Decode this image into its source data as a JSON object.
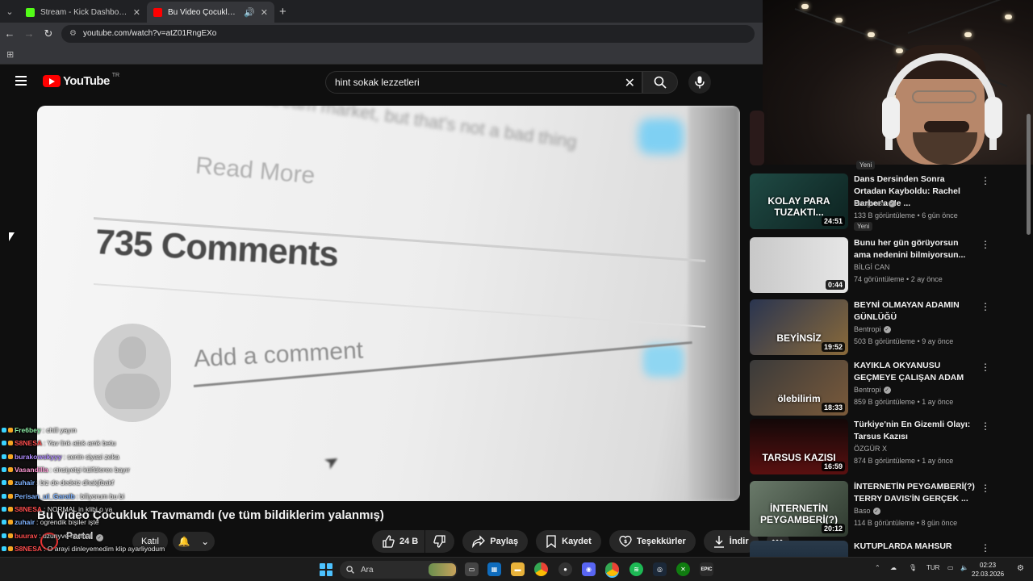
{
  "browser": {
    "tabs": [
      {
        "title": "Stream - Kick Dashboard",
        "favicon_color": "#53fc18",
        "active": false
      },
      {
        "title": "Bu Video Çocukluk Travmamdı",
        "favicon_color": "#ff0000",
        "active": true
      }
    ],
    "new_tab_label": "+",
    "url": "youtube.com/watch?v=atZ01RngEXo"
  },
  "youtube": {
    "logo_text": "YouTube",
    "country_code": "TR",
    "search_value": "hint sokak lezzetleri"
  },
  "video": {
    "frame_text_top": "mainstream market, but that's not a bad thing",
    "frame_read_more": "Read More",
    "frame_comments": "735 Comments",
    "frame_add_comment": "Add a comment",
    "title": "Bu Video Çocukluk Travmamdı (ve tüm bildiklerim yalanmış)",
    "channel_name": "Partal",
    "join_label": "Katıl",
    "like_count": "24 B",
    "share_label": "Paylaş",
    "save_label": "Kaydet",
    "thanks_label": "Teşekkürler",
    "download_label": "İndir"
  },
  "chat": [
    {
      "user": "Fre6bey",
      "msg": ": chill yayın",
      "color": "#8be9a3"
    },
    {
      "user": "S8NESA",
      "msg": ": Yav link attık amk betu",
      "color": "#ff4d4d"
    },
    {
      "user": "burakowskyyy",
      "msg": ": senin siyasi zeka",
      "color": "#b18cff"
    },
    {
      "user": "Vasandilla",
      "msg": ": cinsiyetçi külfülerex bayır",
      "color": "#ff9ad5"
    },
    {
      "user": "zuhair",
      "msg": ": biz de dedeiz dhakjfbakf",
      "color": "#7fb3ff"
    },
    {
      "user": "Perisan_ul_Garaib",
      "msg": ": biliyorum bu bi",
      "color": "#7fb3ff"
    },
    {
      "user": "S8NESA",
      "msg": ": NORMAL in klibi o ya",
      "color": "#ff4d4d"
    },
    {
      "user": "zuhair",
      "msg": ": ogrendik bişiler işte",
      "color": "#7fb3ff"
    },
    {
      "user": "buurav",
      "msg": ": uzunyve normal",
      "color": "#ff4d4d"
    },
    {
      "user": "S8NESA",
      "msg": ": O arayi dinleyemedim klip ayarliyodum",
      "color": "#ff4d4d"
    },
    {
      "user": "S8NESA",
      "msg": ": Banlandı mı",
      "color": "#ff4d4d"
    },
    {
      "user": "Perisan_ul_Garaib",
      "msg": ": ne olcak aw cinayet işte",
      "color": "#7fb3ff"
    }
  ],
  "sidebar": {
    "top_badge": "Yeni",
    "recs": [
      {
        "title": "Dans Dersinden Sonra Ortadan Kayboldu: Rachel Barber'a Ne ...",
        "channel": "Pangvoss",
        "verified": true,
        "meta": "133 B görüntüleme • 6 gün önce",
        "duration": "24:51",
        "badge": "Yeni",
        "thumb_text": "KOLAY PARA TUZAKTI...",
        "thumb_bg": "linear-gradient(135deg,#1f4a44,#0d2220)"
      },
      {
        "title": "Bunu her gün görüyorsun ama nedenini bilmiyorsun...",
        "channel": "BİLGİ CAN",
        "verified": false,
        "meta": "74 görüntüleme • 2 ay önce",
        "duration": "0:44",
        "badge": "",
        "thumb_text": "",
        "thumb_bg": "linear-gradient(90deg,#c8c8c8,#e6e6e6)"
      },
      {
        "title": "BEYNİ OLMAYAN ADAMIN GÜNLÜĞÜ",
        "channel": "Bentropi",
        "verified": true,
        "meta": "503 B görüntüleme • 9 ay önce",
        "duration": "19:52",
        "badge": "",
        "thumb_text": "BEYİNSİZ",
        "thumb_bg": "linear-gradient(135deg,#2a3550,#8a6a3a)"
      },
      {
        "title": "KAYIKLA OKYANUSU GEÇMEYE ÇALIŞAN ADAM",
        "channel": "Bentropi",
        "verified": true,
        "meta": "859 B görüntüleme • 1 ay önce",
        "duration": "18:33",
        "badge": "",
        "thumb_text": "ölebilirim",
        "thumb_bg": "linear-gradient(135deg,#3a3a3a,#7a5a3a)"
      },
      {
        "title": "Türkiye'nin En Gizemli Olayı: Tarsus Kazısı",
        "channel": "ÖZGÜR X",
        "verified": false,
        "meta": "874 B görüntüleme • 1 ay önce",
        "duration": "16:59",
        "badge": "",
        "thumb_text": "TARSUS KAZISI",
        "thumb_bg": "linear-gradient(180deg,#120808,#5a1010)"
      },
      {
        "title": "İNTERNETİN PEYGAMBERİ(?) TERRY DAVIS'İN GERÇEK ...",
        "channel": "Baso",
        "verified": true,
        "meta": "114 B görüntüleme • 8 gün önce",
        "duration": "20:12",
        "badge": "",
        "thumb_text": "İNTERNETİN PEYGAMBERİ(?)",
        "thumb_bg": "linear-gradient(135deg,#6a7a6a,#2f3a2f)"
      },
      {
        "title": "KUTUPLARDA MAHSUR",
        "channel": "",
        "verified": false,
        "meta": "",
        "duration": "",
        "badge": "",
        "thumb_text": "BUZULDA MAHSUR",
        "thumb_bg": "linear-gradient(180deg,#2a3a4a,#0a1a2a)"
      }
    ]
  },
  "taskbar": {
    "search_placeholder": "Ara",
    "lang": "TUR",
    "time": "02:23",
    "date": "22.03.2026",
    "epic_label": "EPIC"
  }
}
